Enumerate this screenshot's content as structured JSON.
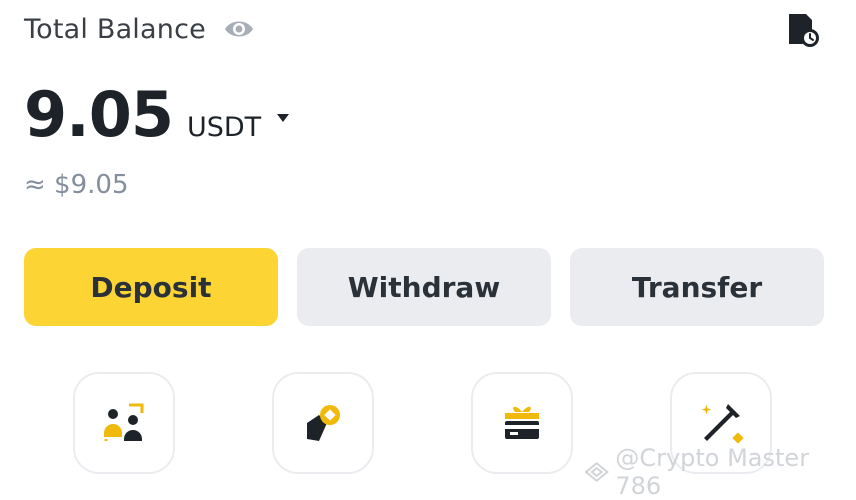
{
  "header": {
    "title": "Total Balance",
    "visibility_icon": "eye-icon",
    "history_icon": "history-clock-icon"
  },
  "balance": {
    "amount": "9.05",
    "currency": "USDT",
    "fiat_equivalent": "≈ $9.05"
  },
  "actions": {
    "deposit_label": "Deposit",
    "withdraw_label": "Withdraw",
    "transfer_label": "Transfer"
  },
  "shortcuts": [
    {
      "icon": "p2p-users-icon"
    },
    {
      "icon": "pay-hand-coin-icon"
    },
    {
      "icon": "gift-card-icon"
    },
    {
      "icon": "mining-pickaxe-icon"
    }
  ],
  "watermark": {
    "text": "@Crypto Master 786"
  },
  "colors": {
    "accent": "#fcd535",
    "button_secondary": "#eaecef",
    "text_primary": "#1e2329",
    "text_secondary": "#848e9c",
    "icon_dark": "#1e2329",
    "icon_yellow": "#f0b90b"
  }
}
